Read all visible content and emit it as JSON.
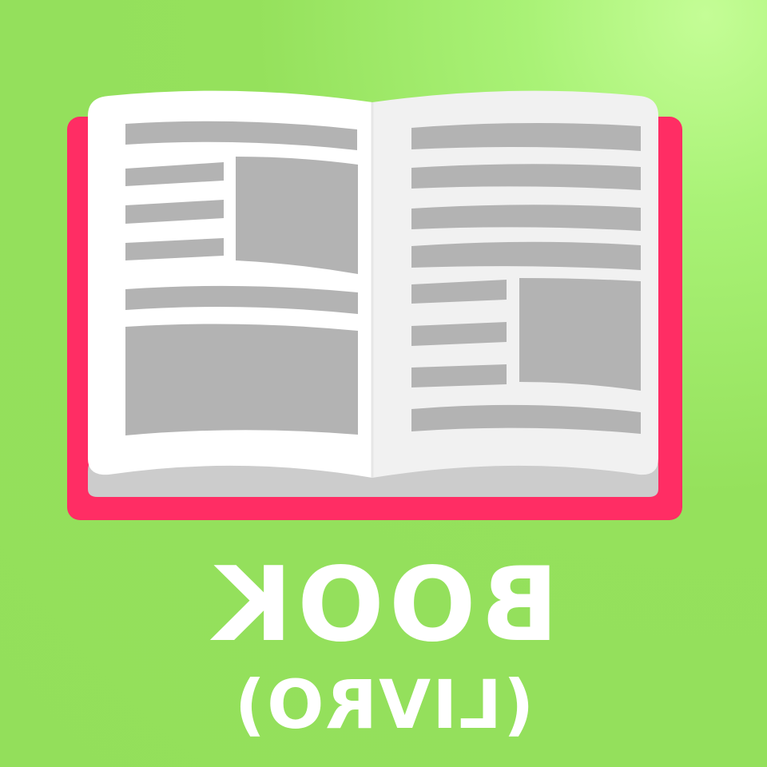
{
  "word": "BOOK",
  "translation": "(LIVRO)",
  "icon": "open-book-icon",
  "colors": {
    "background": "#95e15c",
    "cover": "#ff2d64",
    "page": "#ffffff",
    "page_shade": "#f0f0f0",
    "page_edge": "#cccccc",
    "content": "#b3b3b3",
    "text": "#ffffff"
  }
}
